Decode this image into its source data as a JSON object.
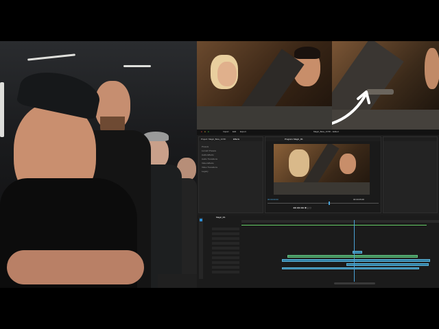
{
  "scene": {
    "left_photo": "people-watching-editor",
    "right_top": "movie-stills-comparison",
    "right_bottom": "video-editor-timeline"
  },
  "editor": {
    "window_title": "Magic_Beta_13.5K - Edited",
    "menu_items": [
      "Import",
      "Edit",
      "Export"
    ],
    "project_panel_label": "Project: Magic_Beta_13.5K",
    "effects_tab": "Effects",
    "program_label": "Program: Magic_R1",
    "effect_list": [
      "Presets",
      "Lumetri Presets",
      "Audio Effects",
      "Audio Transitions",
      "Video Effects",
      "Video Transitions",
      "Legacy"
    ],
    "sequence_tab": "Magic_R1",
    "timecode_left": "00:00:00:00",
    "timecode_right": "00:00:05:08"
  },
  "colors": {
    "clip_blue": "#2f7fa5",
    "clip_green": "#3e8f5a",
    "playhead": "#4aa3d8",
    "arrow": "#ffffff"
  }
}
